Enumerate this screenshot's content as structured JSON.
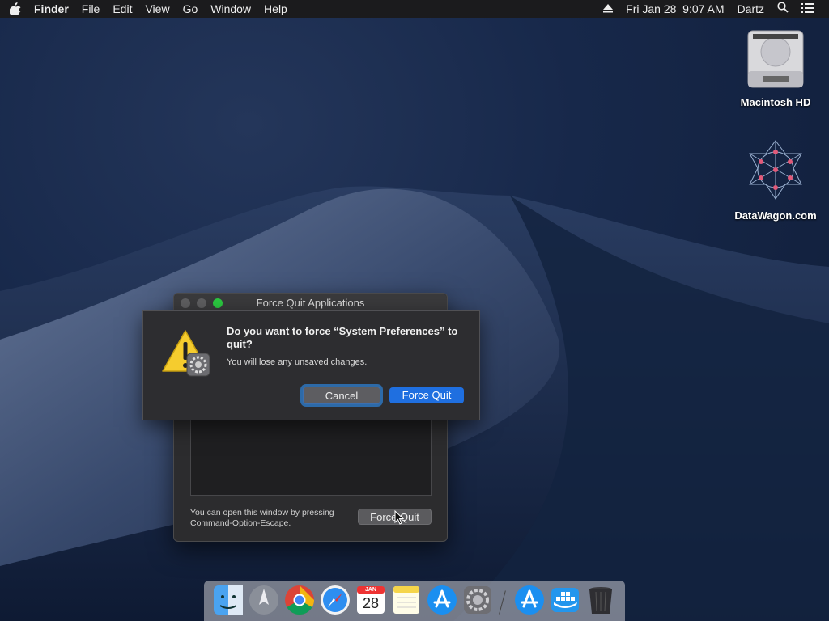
{
  "menubar": {
    "app_name": "Finder",
    "items": [
      "File",
      "Edit",
      "View",
      "Go",
      "Window",
      "Help"
    ],
    "date_time": "Fri Jan 28  9:07 AM",
    "user": "Dartz",
    "icons": [
      "apple-icon",
      "eject-icon",
      "search-icon",
      "list-icon"
    ]
  },
  "desktop": {
    "icons": [
      {
        "label": "Macintosh HD",
        "icon": "hard-drive-icon"
      },
      {
        "label": "DataWagon.com",
        "icon": "network-graph-icon"
      }
    ]
  },
  "force_quit_window": {
    "title": "Force Quit Applications",
    "hint": "You can open this window by pressing Command-Option-Escape.",
    "button": "Force Quit"
  },
  "alert": {
    "title": "Do you want to force “System Preferences” to quit?",
    "message": "You will lose any unsaved changes.",
    "cancel_label": "Cancel",
    "confirm_label": "Force Quit",
    "icon": "warning-icon"
  },
  "dock": {
    "calendar_month": "JAN",
    "calendar_day": "28",
    "apps": [
      "finder-icon",
      "launchpad-icon",
      "chrome-icon",
      "safari-icon",
      "calendar-icon",
      "notes-icon",
      "app-store-icon",
      "system-preferences-icon",
      "app-store-icon",
      "docker-icon",
      "trash-icon"
    ]
  },
  "colors": {
    "accent": "#1f6fe0",
    "menubar_bg": "#1b1b1d",
    "window_bg": "#2c2c2e"
  }
}
